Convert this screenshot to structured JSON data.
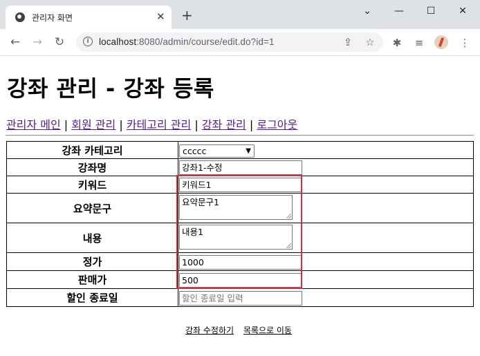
{
  "browser": {
    "tab_title": "관리자 화면",
    "tab_close": "✕",
    "new_tab": "+",
    "url_host": "localhost",
    "url_rest": ":8080/admin/course/edit.do?id=1",
    "window_controls": {
      "menu": "⌄",
      "minimize": "—",
      "maximize": "☐",
      "close": "✕"
    }
  },
  "page": {
    "title": "강좌 관리 - 강좌 등록",
    "nav": [
      {
        "label": "관리자 메인"
      },
      {
        "label": "회원 관리"
      },
      {
        "label": "카테고리 관리"
      },
      {
        "label": "강좌 관리"
      },
      {
        "label": "로그아웃"
      }
    ],
    "nav_separator": "|"
  },
  "form": {
    "category": {
      "label": "강좌 카테고리",
      "selected": "ccccc"
    },
    "name": {
      "label": "강좌명",
      "value": "강좌1-수정"
    },
    "keyword": {
      "label": "키워드",
      "value": "키워드1"
    },
    "summary": {
      "label": "요약문구",
      "value": "요약문구1"
    },
    "contents": {
      "label": "내용",
      "value": "내용1"
    },
    "price": {
      "label": "정가",
      "value": "1000"
    },
    "sale_price": {
      "label": "판매가",
      "value": "500"
    },
    "sale_end": {
      "label": "할인 종료일",
      "placeholder": "할인 종료일 입력"
    }
  },
  "actions": {
    "submit_label": "강좌 수정하기",
    "list_label": "목록으로 이동"
  },
  "colors": {
    "highlight": "#d32f3a",
    "visited_link": "#551a8b",
    "tabstrip": "#dee1e6"
  }
}
